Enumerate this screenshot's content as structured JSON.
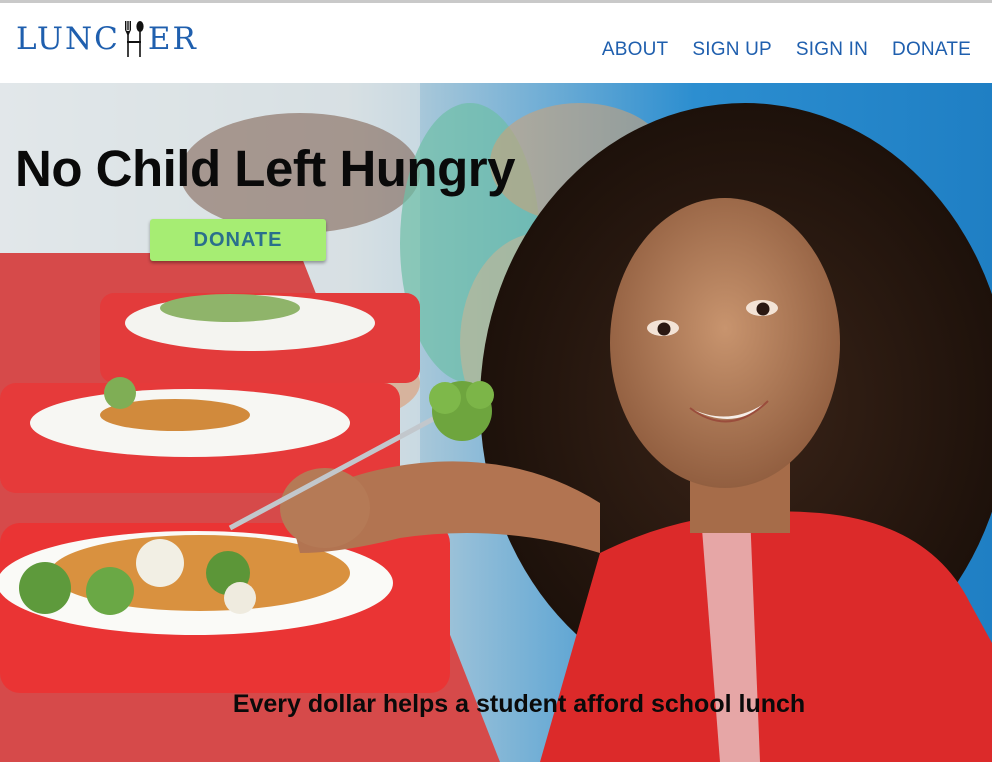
{
  "brand": {
    "name_left": "LUNC",
    "name_right": "ER",
    "color": "#1f5fae"
  },
  "nav": {
    "links": [
      {
        "label": "ABOUT"
      },
      {
        "label": "SIGN UP"
      },
      {
        "label": "SIGN IN"
      },
      {
        "label": "DONATE"
      }
    ]
  },
  "hero": {
    "title": "No Child Left Hungry",
    "cta_label": "DONATE",
    "cta_color": "#a6ed73",
    "tagline": "Every dollar helps a student afford school lunch",
    "photo_icon": "child-eating-lunch-photo"
  }
}
